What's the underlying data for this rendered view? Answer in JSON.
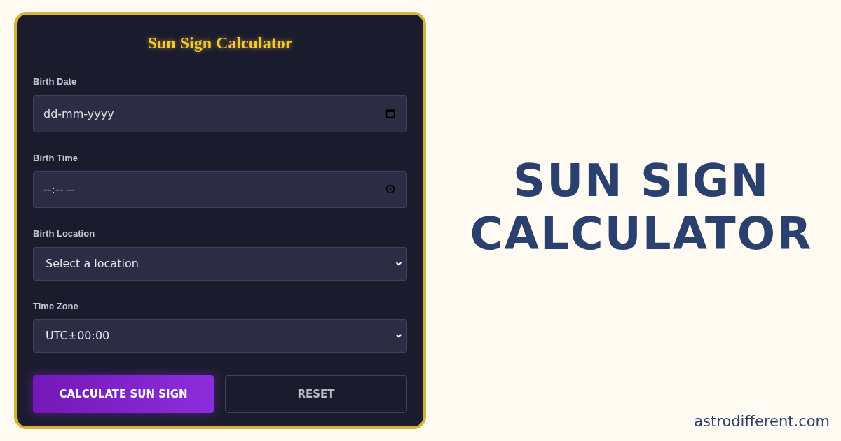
{
  "form": {
    "title": "Sun Sign Calculator",
    "fields": [
      {
        "label": "Birth Date",
        "kind": "date",
        "placeholder": "dd-mm-yyyy"
      },
      {
        "label": "Birth Time",
        "kind": "time",
        "placeholder": "--:-- --"
      },
      {
        "label": "Birth Location",
        "kind": "select",
        "value": "Select a location"
      },
      {
        "label": "Time Zone",
        "kind": "select",
        "value": "UTC±00:00"
      }
    ],
    "buttons": [
      {
        "label": "CALCULATE SUN SIGN",
        "kind": "primary"
      },
      {
        "label": "RESET",
        "kind": "secondary"
      }
    ]
  },
  "headline": [
    "SUN SIGN",
    "CALCULATOR"
  ],
  "footer": "astrodifferent.com"
}
